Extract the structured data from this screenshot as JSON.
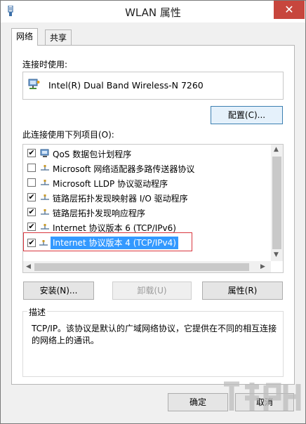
{
  "window": {
    "title": "WLAN 属性",
    "close_label": "✕"
  },
  "tabs": [
    {
      "label": "网络",
      "active": true
    },
    {
      "label": "共享",
      "active": false
    }
  ],
  "connect_using": {
    "label": "连接时使用:",
    "adapter_name": "Intel(R) Dual Band Wireless-N 7260",
    "configure_label": "配置(C)..."
  },
  "items_section": {
    "label": "此连接使用下列项目(O):",
    "items": [
      {
        "label": "QoS 数据包计划程序",
        "checked": true,
        "icon": "qos-scheduler-icon"
      },
      {
        "label": "Microsoft 网络适配器多路传送器协议",
        "checked": false,
        "icon": "protocol-icon"
      },
      {
        "label": "Microsoft LLDP 协议驱动程序",
        "checked": false,
        "icon": "protocol-icon"
      },
      {
        "label": "链路层拓扑发现映射器 I/O 驱动程序",
        "checked": true,
        "icon": "protocol-icon"
      },
      {
        "label": "链路层拓扑发现响应程序",
        "checked": true,
        "icon": "protocol-icon"
      },
      {
        "label": "Internet 协议版本 6 (TCP/IPv6)",
        "checked": true,
        "icon": "protocol-icon"
      },
      {
        "label": "Internet 协议版本 4 (TCP/IPv4)",
        "checked": true,
        "icon": "protocol-icon",
        "selected": true
      }
    ]
  },
  "buttons": {
    "install": "安装(N)...",
    "uninstall": "卸载(U)",
    "properties": "属性(R)",
    "ok": "确定",
    "cancel": "取消"
  },
  "description": {
    "title": "描述",
    "text": "TCP/IP。该协议是默认的广域网络协议，它提供在不同的相互连接的网络上的通讯。"
  },
  "colors": {
    "selection": "#3399ff",
    "close_button": "#c7463d",
    "highlight_outline": "#d9363e"
  }
}
